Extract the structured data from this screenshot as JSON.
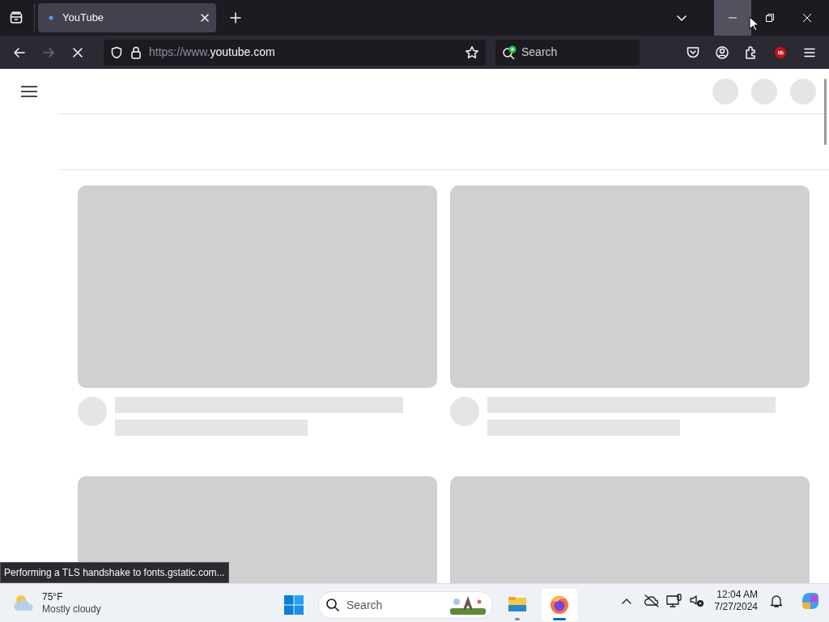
{
  "browser": {
    "tabs": [
      {
        "title": "YouTube",
        "loading": true,
        "selected": true
      }
    ],
    "window_controls": [
      {
        "kind": "minimize",
        "hovered": true
      },
      {
        "kind": "restore",
        "hovered": false
      },
      {
        "kind": "close",
        "hovered": false
      }
    ],
    "navigation": {
      "back_disabled": false,
      "forward_disabled": true,
      "loading": true
    },
    "address_bar": {
      "url_scheme": "https://www.",
      "url_domain": "youtube.com"
    },
    "search_box": {
      "placeholder": "Search"
    },
    "status_text": "Performing a TLS handshake to fonts.gstatic.com..."
  },
  "page": {
    "feed": [
      {
        "kind": "skeleton"
      },
      {
        "kind": "skeleton"
      },
      {
        "kind": "skeleton_thumbnail"
      },
      {
        "kind": "skeleton_thumbnail"
      }
    ]
  },
  "taskbar": {
    "weather": {
      "temperature": "75°F",
      "condition": "Mostly cloudy"
    },
    "search": {
      "placeholder": "Search"
    },
    "apps": [
      {
        "kind": "files",
        "active": false
      },
      {
        "kind": "firefox",
        "active": true
      }
    ],
    "time": "12:04 AM",
    "date": "7/27/2024"
  }
}
